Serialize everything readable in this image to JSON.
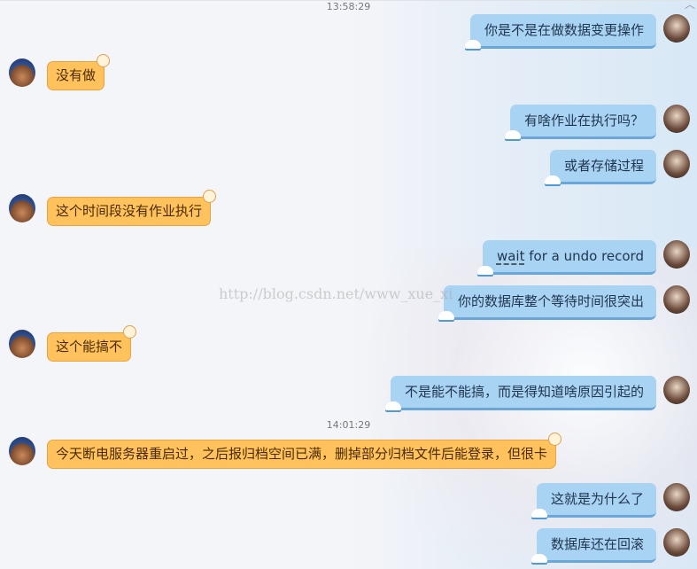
{
  "timestamps": [
    "13:58:29",
    "14:01:29"
  ],
  "watermark": "http://blog.csdn.net/www_xue_xi",
  "messages": [
    {
      "side": "right",
      "text": "你是不是在做数据变更操作"
    },
    {
      "side": "left",
      "text": "没有做"
    },
    {
      "side": "right",
      "text": "有啥作业在执行吗？"
    },
    {
      "side": "right",
      "text": "或者存储过程"
    },
    {
      "side": "left",
      "text": "这个时间段没有作业执行"
    },
    {
      "side": "right",
      "text_prefix": "wait",
      "text": " for a undo record"
    },
    {
      "side": "right",
      "text": "你的数据库整个等待时间很突出"
    },
    {
      "side": "left",
      "text": "这个能搞不"
    },
    {
      "side": "right",
      "text": "不是能不能搞，而是得知道啥原因引起的"
    },
    {
      "side": "left",
      "text": "今天断电服务器重启过，之后报归档空间已满，删掉部分归档文件后能登录，但很卡"
    },
    {
      "side": "right",
      "text": "这就是为什么了"
    },
    {
      "side": "right",
      "text": "数据库还在回滚"
    }
  ],
  "colors": {
    "my_bubble": "#a9d3f2",
    "their_bubble": "#ffc25c"
  },
  "icons": {
    "close": "collapse-icon"
  }
}
